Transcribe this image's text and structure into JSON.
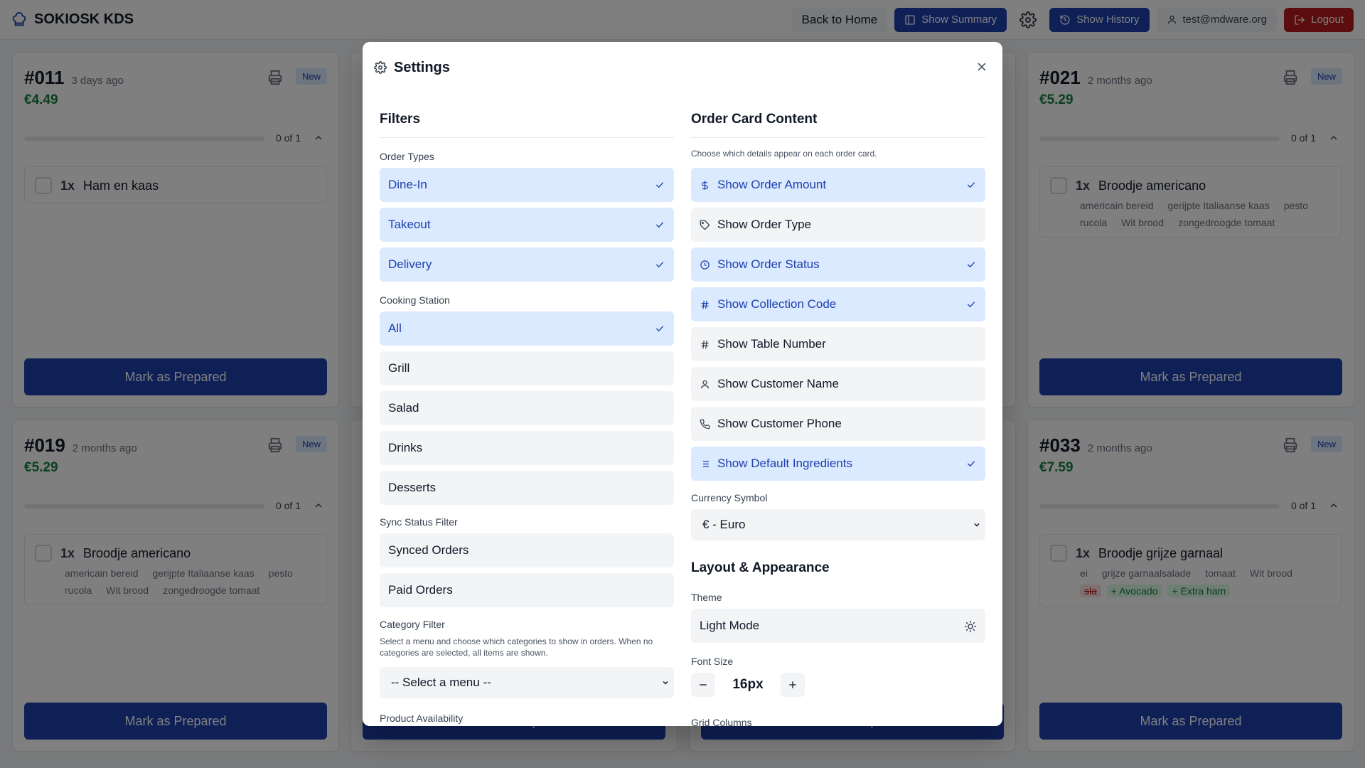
{
  "app": {
    "title": "SOKIOSK KDS"
  },
  "topbar": {
    "back_label": "Back to Home",
    "summary_label": "Show Summary",
    "history_label": "Show History",
    "user_email": "test@mdware.org",
    "logout_label": "Logout"
  },
  "orders": [
    {
      "number": "#011",
      "time": "3 days ago",
      "amount": "€4.49",
      "badge": "New",
      "progress": "0 of 1",
      "progress_fraction": 0,
      "item": {
        "qty": "1x",
        "name": "Ham en kaas",
        "ingredients": [],
        "removed": [],
        "extras": []
      },
      "action": "Mark as Prepared"
    },
    {
      "number": "#021",
      "time": "2 months ago",
      "amount": "€5.29",
      "badge": "New",
      "progress": "0 of 1",
      "progress_fraction": 0,
      "item": {
        "qty": "1x",
        "name": "Broodje americano",
        "ingredients": [
          "americain bereid",
          "gerijpte Italiaanse kaas",
          "pesto",
          "rucola",
          "Wit brood",
          "zongedroogde tomaat"
        ],
        "removed": [],
        "extras": []
      },
      "action": "Mark as Prepared"
    },
    {
      "number": "#019",
      "time": "2 months ago",
      "amount": "€5.29",
      "badge": "New",
      "progress": "0 of 1",
      "progress_fraction": 0,
      "item": {
        "qty": "1x",
        "name": "Broodje americano",
        "ingredients": [
          "americain bereid",
          "gerijpte Italiaanse kaas",
          "pesto",
          "rucola",
          "Wit brood",
          "zongedroogde tomaat"
        ],
        "removed": [],
        "extras": []
      },
      "action": "Mark as Prepared"
    },
    {
      "number": "#033",
      "time": "2 months ago",
      "amount": "€7.59",
      "badge": "New",
      "progress": "0 of 1",
      "progress_fraction": 0,
      "item": {
        "qty": "1x",
        "name": "Broodje grijze garnaal",
        "ingredients": [
          "ei",
          "grijze garnaalsalade",
          "tomaat",
          "Wit brood"
        ],
        "removed": [
          "sla"
        ],
        "extras": [
          "+ Avocado",
          "+ Extra ham"
        ]
      },
      "action": "Mark as Prepared"
    }
  ],
  "settings": {
    "title": "Settings",
    "filters": {
      "title": "Filters",
      "order_types_label": "Order Types",
      "order_types": [
        {
          "label": "Dine-In",
          "selected": true
        },
        {
          "label": "Takeout",
          "selected": true
        },
        {
          "label": "Delivery",
          "selected": true
        }
      ],
      "cooking_station_label": "Cooking Station",
      "stations": [
        {
          "label": "All",
          "selected": true
        },
        {
          "label": "Grill",
          "selected": false
        },
        {
          "label": "Salad",
          "selected": false
        },
        {
          "label": "Drinks",
          "selected": false
        },
        {
          "label": "Desserts",
          "selected": false
        }
      ],
      "sync_label": "Sync Status Filter",
      "sync": [
        {
          "label": "Synced Orders",
          "selected": false
        },
        {
          "label": "Paid Orders",
          "selected": false
        }
      ],
      "category_label": "Category Filter",
      "category_desc": "Select a menu and choose which categories to show in orders. When no categories are selected, all items are shown.",
      "menu_select": "-- Select a menu --",
      "product_availability_label": "Product Availability"
    },
    "card_content": {
      "title": "Order Card Content",
      "desc": "Choose which details appear on each order card.",
      "options": [
        {
          "label": "Show Order Amount",
          "icon": "dollar-icon",
          "selected": true
        },
        {
          "label": "Show Order Type",
          "icon": "tag-icon",
          "selected": false
        },
        {
          "label": "Show Order Status",
          "icon": "clock-icon",
          "selected": true
        },
        {
          "label": "Show Collection Code",
          "icon": "hash-icon",
          "selected": true
        },
        {
          "label": "Show Table Number",
          "icon": "hash-icon",
          "selected": false
        },
        {
          "label": "Show Customer Name",
          "icon": "user-icon",
          "selected": false
        },
        {
          "label": "Show Customer Phone",
          "icon": "phone-icon",
          "selected": false
        },
        {
          "label": "Show Default Ingredients",
          "icon": "list-icon",
          "selected": true
        }
      ],
      "currency_label": "Currency Symbol",
      "currency_value": "€ - Euro"
    },
    "layout": {
      "title": "Layout & Appearance",
      "theme_label": "Theme",
      "theme_value": "Light Mode",
      "font_size_label": "Font Size",
      "font_size_value": "16px",
      "grid_columns_label": "Grid Columns"
    }
  },
  "colors": {
    "primary": "#1e40af",
    "selected_bg": "#dbeafe",
    "amount_green": "#15803d",
    "danger": "#b91c1c"
  }
}
